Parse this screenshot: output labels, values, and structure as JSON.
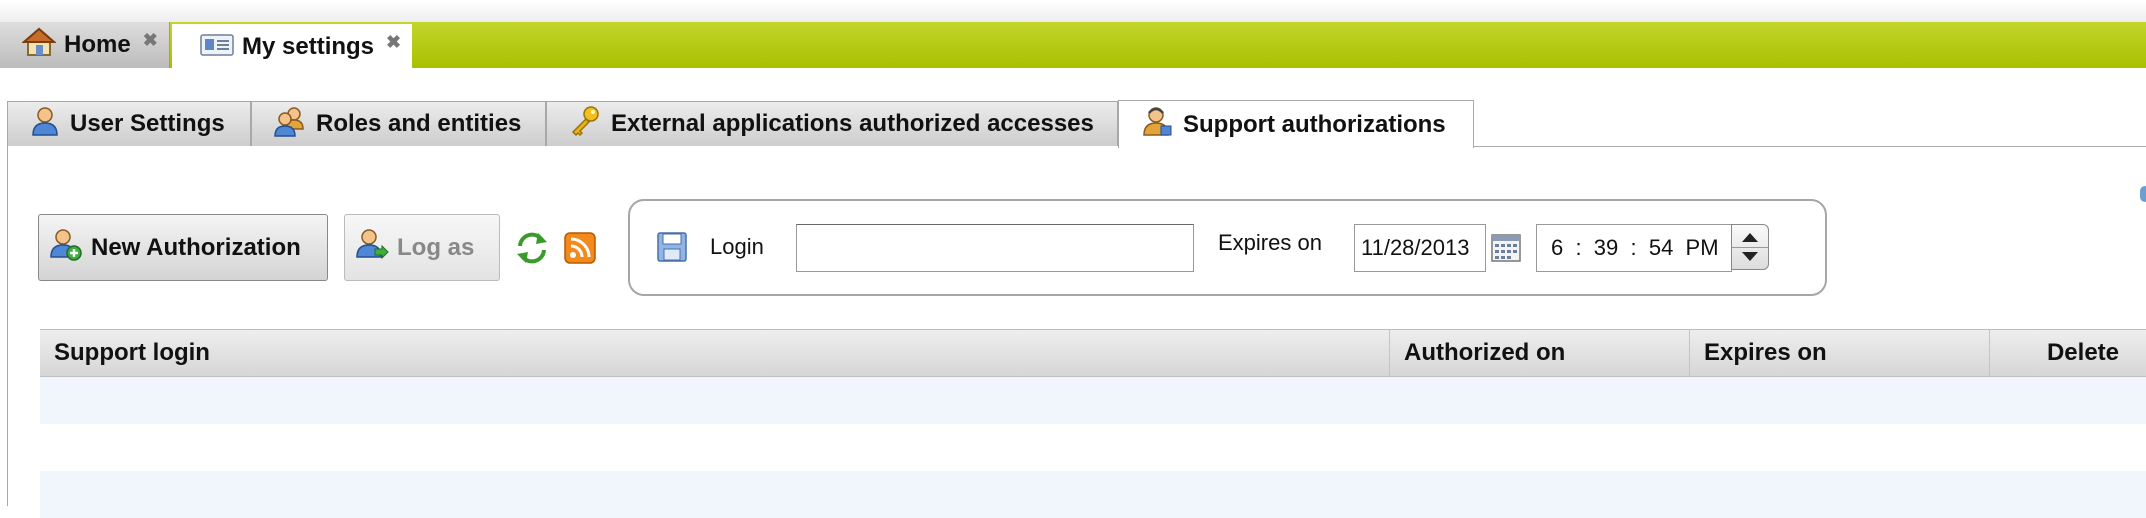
{
  "outer_tabs": [
    {
      "label": "Home",
      "close": "✖"
    },
    {
      "label": "My settings",
      "close": "✖"
    }
  ],
  "inner_tabs": [
    {
      "label": "User Settings"
    },
    {
      "label": "Roles and entities"
    },
    {
      "label": "External applications authorized accesses"
    },
    {
      "label": "Support authorizations"
    }
  ],
  "toolbar": {
    "new_label": "New Authorization",
    "logas_label": "Log as"
  },
  "form": {
    "login_label": "Login",
    "login_value": "",
    "expires_label": "Expires on",
    "date_value": "11/28/2013",
    "time_value": "6  :  39  :  54  PM"
  },
  "table": {
    "columns": [
      "Support login",
      "Authorized on",
      "Expires on",
      "Delete"
    ],
    "rows": []
  },
  "colors": {
    "accent_bar": "#b5cc12",
    "row_alt": "#f1f6fd"
  },
  "icons": [
    "home-icon",
    "contact-card-icon",
    "user-icon",
    "users-icon",
    "key-icon",
    "support-user-icon",
    "user-add-icon",
    "user-login-icon",
    "refresh-icon",
    "rss-icon",
    "save-icon",
    "calendar-icon"
  ]
}
